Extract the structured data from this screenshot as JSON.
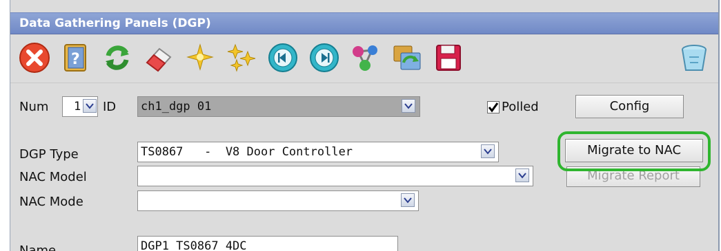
{
  "window": {
    "title": "Data Gathering Panels (DGP)"
  },
  "toolbar": {
    "icons": [
      "close-icon",
      "help-book-icon",
      "refresh-icon",
      "eraser-icon",
      "new-sparkle-icon",
      "sparkle-group-icon",
      "first-record-icon",
      "next-record-icon",
      "network-nodes-icon",
      "transfer-icon",
      "save-floppy-icon",
      "recycle-bin-icon"
    ]
  },
  "form": {
    "num_label": "Num",
    "num_value": "1",
    "id_label": "ID",
    "id_value": "ch1_dgp 01",
    "polled_label": "Polled",
    "polled_checked": true,
    "config_button": "Config",
    "dgp_type_label": "DGP Type",
    "dgp_type_value": "TS0867   -  V8 Door Controller",
    "nac_model_label": "NAC Model",
    "nac_model_value": "",
    "nac_mode_label": "NAC Mode",
    "nac_mode_value": "",
    "migrate_button": "Migrate to NAC",
    "migrate_report_button": "Migrate Report",
    "name_label": "Name",
    "name_value": "DGP1 TS0867 4DC"
  },
  "colors": {
    "titlebar": "#7f97cf",
    "highlight": "#2fb52f",
    "panel": "#dcdcdc"
  }
}
